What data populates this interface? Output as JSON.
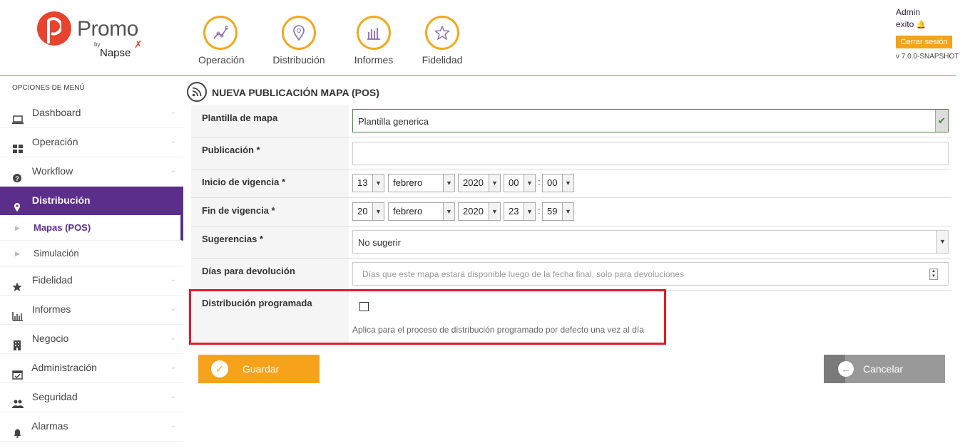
{
  "brand": {
    "name": "Promo",
    "by": "by",
    "company": "Napse"
  },
  "topnav": [
    {
      "label": "Operación",
      "icon": "chart-line-icon"
    },
    {
      "label": "Distribución",
      "icon": "map-pin-icon"
    },
    {
      "label": "Informes",
      "icon": "bar-chart-icon"
    },
    {
      "label": "Fidelidad",
      "icon": "star-icon"
    }
  ],
  "user": {
    "name": "Admin",
    "status": "exito",
    "logout_label": "Cerrar sesión",
    "version": "v 7.0.0-SNAPSHOT"
  },
  "sidebar": {
    "heading": "OPCIONES DE MENÚ",
    "items": [
      {
        "label": "Dashboard",
        "icon": "laptop-icon"
      },
      {
        "label": "Operación",
        "icon": "grid-icon"
      },
      {
        "label": "Workflow",
        "icon": "question-circle-icon"
      },
      {
        "label": "Distribución",
        "icon": "map-marker-icon",
        "active": true
      },
      {
        "label": "Mapas (POS)",
        "sub": true,
        "active": true
      },
      {
        "label": "Simulación",
        "sub": true
      },
      {
        "label": "Fidelidad",
        "icon": "star-icon"
      },
      {
        "label": "Informes",
        "icon": "bar-chart-icon"
      },
      {
        "label": "Negocio",
        "icon": "building-icon"
      },
      {
        "label": "Administración",
        "icon": "calendar-check-icon"
      },
      {
        "label": "Seguridad",
        "icon": "users-icon"
      },
      {
        "label": "Alarmas",
        "icon": "bell-icon"
      }
    ]
  },
  "page": {
    "title": "NUEVA PUBLICACIÓN MAPA (POS)"
  },
  "form": {
    "template": {
      "label": "Plantilla de mapa",
      "value": "Plantilla generica"
    },
    "publication": {
      "label": "Publicación *",
      "value": ""
    },
    "start": {
      "label": "Inicio de vigencia *",
      "day": "13",
      "month": "febrero",
      "year": "2020",
      "hour": "00",
      "minute": "00"
    },
    "end": {
      "label": "Fin de vigencia *",
      "day": "20",
      "month": "febrero",
      "year": "2020",
      "hour": "23",
      "minute": "59"
    },
    "suggestions": {
      "label": "Sugerencias *",
      "value": "No sugerir"
    },
    "return_days": {
      "label": "Días para devolución",
      "placeholder": "Días que este mapa estará disponible luego de la fecha final, solo para devoluciones"
    },
    "scheduled": {
      "label": "Distribución programada",
      "checked": false,
      "hint": "Aplica para el proceso de distribución programado por defecto una vez al día"
    }
  },
  "actions": {
    "save_label": "Guardar",
    "cancel_label": "Cancelar"
  },
  "colors": {
    "accent": "#f7a21b",
    "brand_purple": "#5b2e8c",
    "highlight": "#e01b2b",
    "logo_red": "#e8432e"
  }
}
